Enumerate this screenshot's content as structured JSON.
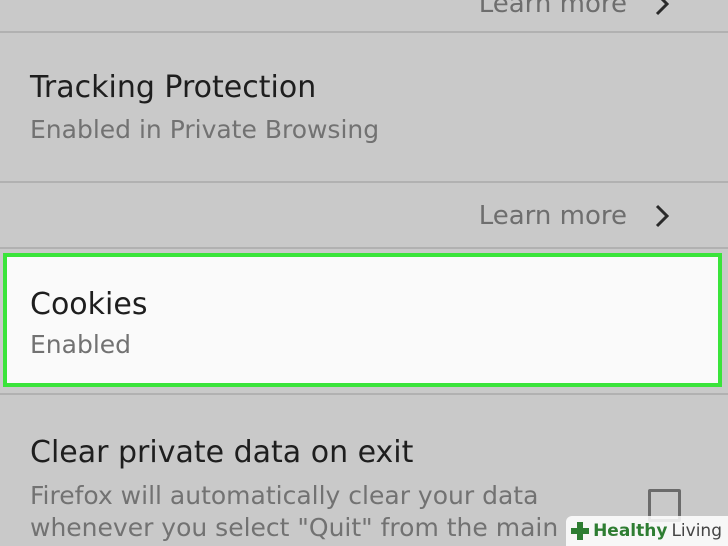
{
  "top_learn_more": {
    "label": "Learn more"
  },
  "tracking": {
    "title": "Tracking Protection",
    "summary": "Enabled in Private Browsing"
  },
  "tracking_learn_more": {
    "label": "Learn more"
  },
  "cookies": {
    "title": "Cookies",
    "summary": "Enabled",
    "highlight_color": "#3ae43a"
  },
  "clear_private_data": {
    "title": "Clear private data on exit",
    "summary": "Firefox will automatically clear your data whenever you select \"Quit\" from the main",
    "checked": false
  },
  "watermark": {
    "bold": "Healthy",
    "light": "Living",
    "icon": "plus-icon"
  }
}
